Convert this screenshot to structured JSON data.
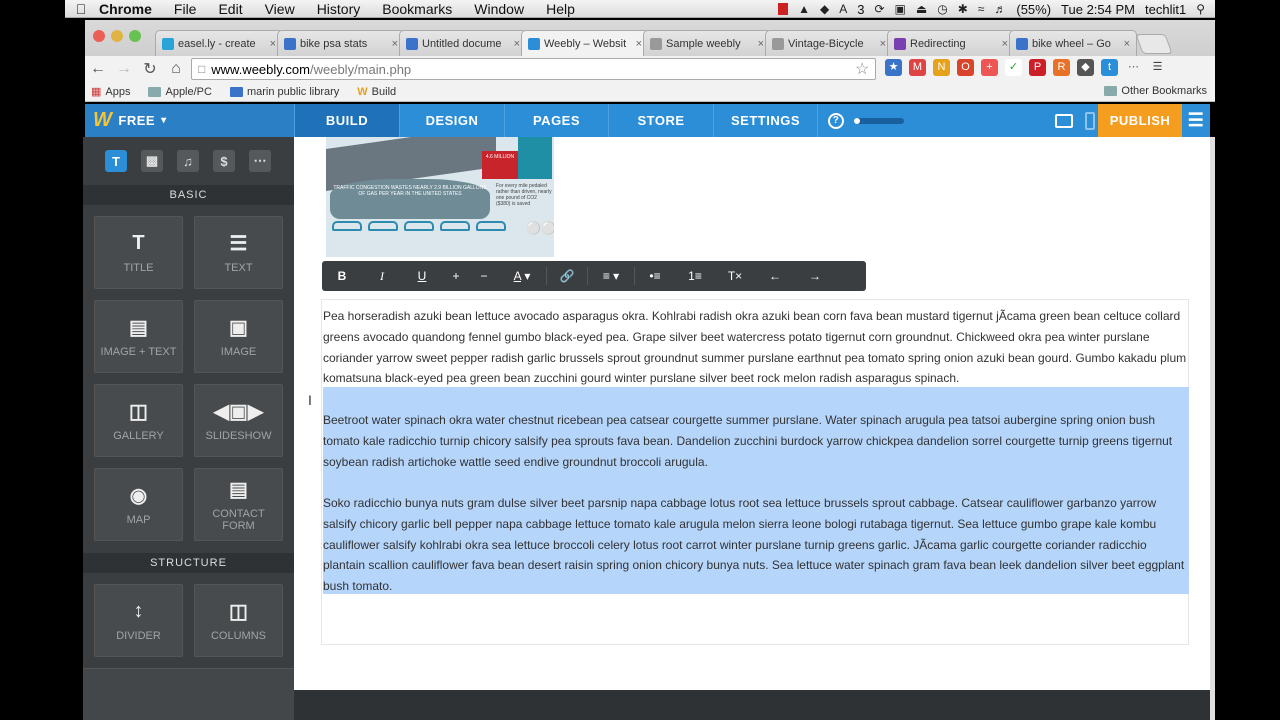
{
  "mac_menubar": {
    "app_name": "Chrome",
    "menus": [
      "File",
      "Edit",
      "View",
      "History",
      "Bookmarks",
      "Window",
      "Help"
    ],
    "battery": "(55%)",
    "clock": "Tue 2:54 PM",
    "user": "techlit1",
    "a_badge": "3"
  },
  "browser": {
    "tabs": [
      {
        "label": "easel.ly - create",
        "fav_color": "#2aa4d8"
      },
      {
        "label": "bike psa stats",
        "fav_color": "#3b73c9"
      },
      {
        "label": "Untitled docume",
        "fav_color": "#3b73c9"
      },
      {
        "label": "Weebly – Websit",
        "fav_color": "#2c8ed6"
      },
      {
        "label": "Sample weebly",
        "fav_color": "#999999"
      },
      {
        "label": "Vintage-Bicycle",
        "fav_color": "#999999"
      },
      {
        "label": "Redirecting",
        "fav_color": "#7a3fb0"
      },
      {
        "label": "bike wheel – Go",
        "fav_color": "#3b73c9"
      }
    ],
    "url_domain": "www.weebly.com",
    "url_path": "/weebly/main.php",
    "bookmarks": [
      {
        "label": "Apps"
      },
      {
        "label": "Apple/PC"
      },
      {
        "label": "marin public library"
      },
      {
        "label": "Build"
      }
    ],
    "other_bookmarks": "Other Bookmarks"
  },
  "weebly_nav": {
    "plan": "FREE",
    "tabs": [
      "BUILD",
      "DESIGN",
      "PAGES",
      "STORE",
      "SETTINGS"
    ],
    "active_tab": "BUILD",
    "publish": "PUBLISH"
  },
  "sidebar": {
    "basic_heading": "BASIC",
    "structure_heading": "STRUCTURE",
    "basic_items": [
      {
        "label": "TITLE",
        "icon": "title-icon"
      },
      {
        "label": "TEXT",
        "icon": "text-icon"
      },
      {
        "label": "IMAGE + TEXT",
        "icon": "image-text-icon"
      },
      {
        "label": "IMAGE",
        "icon": "image-icon"
      },
      {
        "label": "GALLERY",
        "icon": "gallery-icon"
      },
      {
        "label": "SLIDESHOW",
        "icon": "slideshow-icon"
      },
      {
        "label": "MAP",
        "icon": "map-icon"
      },
      {
        "label": "CONTACT FORM",
        "icon": "contact-form-icon"
      }
    ],
    "structure_items": [
      {
        "label": "DIVIDER",
        "icon": "divider-icon"
      },
      {
        "label": "COLUMNS",
        "icon": "columns-icon"
      }
    ]
  },
  "infographic": {
    "stat": "4.6 MILLION",
    "headline": "TRAFFIC CONGESTION WASTES NEARLY 2.9 BILLION GALLONS OF GAS PER YEAR IN THE UNITED STATES",
    "side": "For every mile pedaled rather than driven, nearly one pound of CO2 ($380) is saved"
  },
  "content": {
    "paragraphs": [
      "Pea horseradish azuki bean lettuce avocado asparagus okra. Kohlrabi radish okra azuki bean corn fava bean mustard tigernut jÃ­cama green bean celtuce collard greens avocado quandong fennel gumbo black-eyed pea. Grape silver beet watercress potato tigernut corn groundnut. Chickweed okra pea winter purslane coriander yarrow sweet pepper radish garlic brussels sprout groundnut summer purslane earthnut pea tomato spring onion azuki bean gourd. Gumbo kakadu plum komatsuna black-eyed pea green bean zucchini gourd winter purslane silver beet rock melon radish asparagus spinach.",
      "Beetroot water spinach okra water chestnut ricebean pea catsear courgette summer purslane. Water spinach arugula pea tatsoi aubergine spring onion bush tomato kale radicchio turnip chicory salsify pea sprouts fava bean. Dandelion zucchini burdock yarrow chickpea dandelion sorrel courgette turnip greens tigernut soybean radish artichoke wattle seed endive groundnut broccoli arugula.",
      "Soko radicchio bunya nuts gram dulse silver beet parsnip napa cabbage lotus root sea lettuce brussels sprout cabbage. Catsear cauliflower garbanzo yarrow salsify chicory garlic bell pepper napa cabbage lettuce tomato kale arugula melon sierra leone bologi rutabaga tigernut. Sea lettuce gumbo grape kale kombu cauliflower salsify kohlrabi okra sea lettuce broccoli celery lotus root carrot winter purslane turnip greens garlic. JÃ­cama garlic courgette coriander radicchio plantain scallion cauliflower fava bean desert raisin spring onion chicory bunya nuts. Sea lettuce water spinach gram fava bean leek dandelion silver beet eggplant bush tomato."
    ]
  },
  "colors": {
    "weebly_blue": "#2c8ed6",
    "publish_orange": "#f59d1f",
    "selection": "#b5d5fb",
    "sidebar_bg": "#3b3e41"
  }
}
